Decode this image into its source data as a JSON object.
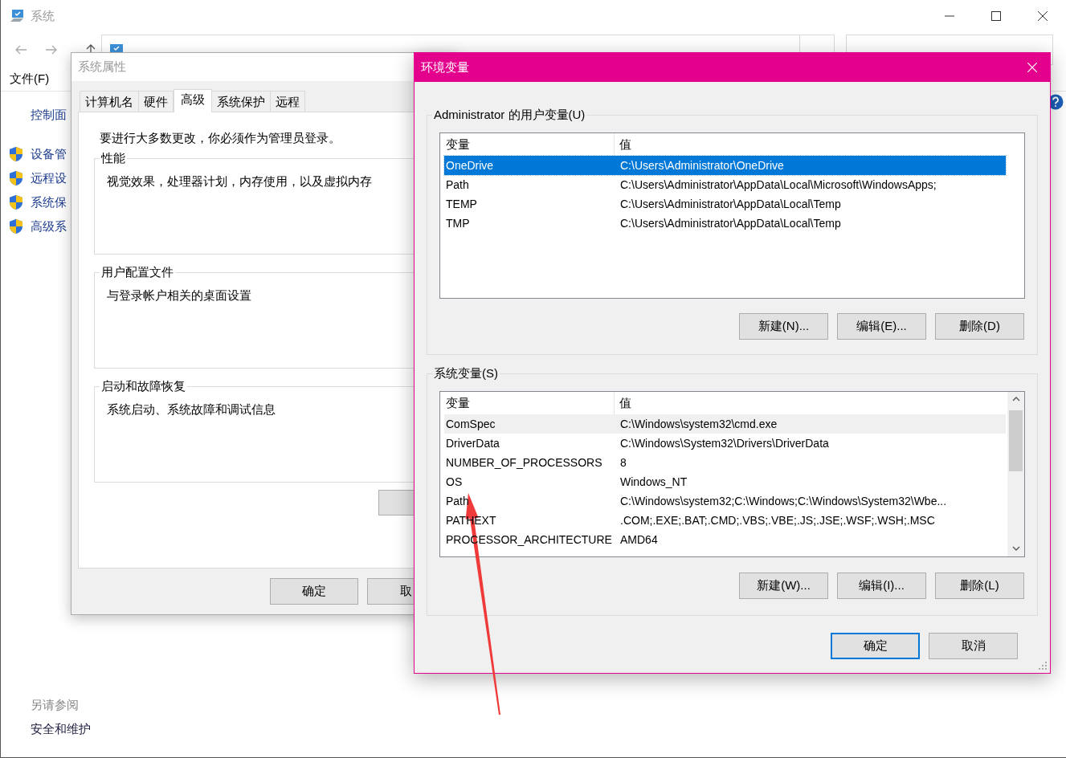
{
  "explorer": {
    "title": "系统",
    "menu": [
      "文件(F)"
    ],
    "sidebar": {
      "home": "控制面",
      "tasks": [
        "设备管",
        "远程设",
        "系统保",
        "高级系"
      ]
    },
    "see_also": {
      "heading": "另请参阅",
      "links": [
        "安全和维护"
      ]
    }
  },
  "system_properties": {
    "title": "系统属性",
    "tabs": [
      {
        "label": "计算机名",
        "selected": false
      },
      {
        "label": "硬件",
        "selected": false
      },
      {
        "label": "高级",
        "selected": true
      },
      {
        "label": "系统保护",
        "selected": false
      },
      {
        "label": "远程",
        "selected": false
      }
    ],
    "notice": "要进行大多数更改，你必须作为管理员登录。",
    "groups": [
      {
        "title": "性能",
        "description": "视觉效果，处理器计划，内存使用，以及虚拟内存"
      },
      {
        "title": "用户配置文件",
        "description": "与登录帐户相关的桌面设置"
      },
      {
        "title": "启动和故障恢复",
        "description": "系统启动、系统故障和调试信息"
      }
    ],
    "buttons": [
      "确定",
      "取"
    ]
  },
  "environment_variables": {
    "title": "环境变量",
    "user_variables": {
      "title": "Administrator 的用户变量(U)",
      "focused": true,
      "columns": [
        "变量",
        "值"
      ],
      "rows": [
        {
          "name": "OneDrive",
          "value": "C:\\Users\\Administrator\\OneDrive",
          "selected": true
        },
        {
          "name": "Path",
          "value": "C:\\Users\\Administrator\\AppData\\Local\\Microsoft\\WindowsApps;",
          "selected": false
        },
        {
          "name": "TEMP",
          "value": "C:\\Users\\Administrator\\AppData\\Local\\Temp",
          "selected": false
        },
        {
          "name": "TMP",
          "value": "C:\\Users\\Administrator\\AppData\\Local\\Temp",
          "selected": false
        }
      ],
      "buttons": [
        "新建(N)...",
        "编辑(E)...",
        "删除(D)"
      ]
    },
    "system_variables": {
      "title": "系统变量(S)",
      "focused": false,
      "columns": [
        "变量",
        "值"
      ],
      "rows": [
        {
          "name": "ComSpec",
          "value": "C:\\Windows\\system32\\cmd.exe",
          "selected": true
        },
        {
          "name": "DriverData",
          "value": "C:\\Windows\\System32\\Drivers\\DriverData",
          "selected": false
        },
        {
          "name": "NUMBER_OF_PROCESSORS",
          "value": "8",
          "selected": false
        },
        {
          "name": "OS",
          "value": "Windows_NT",
          "selected": false
        },
        {
          "name": "Path",
          "value": "C:\\Windows\\system32;C:\\Windows;C:\\Windows\\System32\\Wbe...",
          "selected": false
        },
        {
          "name": "PATHEXT",
          "value": ".COM;.EXE;.BAT;.CMD;.VBS;.VBE;.JS;.JSE;.WSF;.WSH;.MSC",
          "selected": false
        },
        {
          "name": "PROCESSOR_ARCHITECTURE",
          "value": "AMD64",
          "selected": false
        }
      ],
      "buttons": [
        "新建(W)...",
        "编辑(I)...",
        "删除(L)"
      ]
    },
    "buttons": [
      {
        "label": "确定",
        "default": true
      },
      {
        "label": "取消",
        "default": false
      }
    ]
  }
}
